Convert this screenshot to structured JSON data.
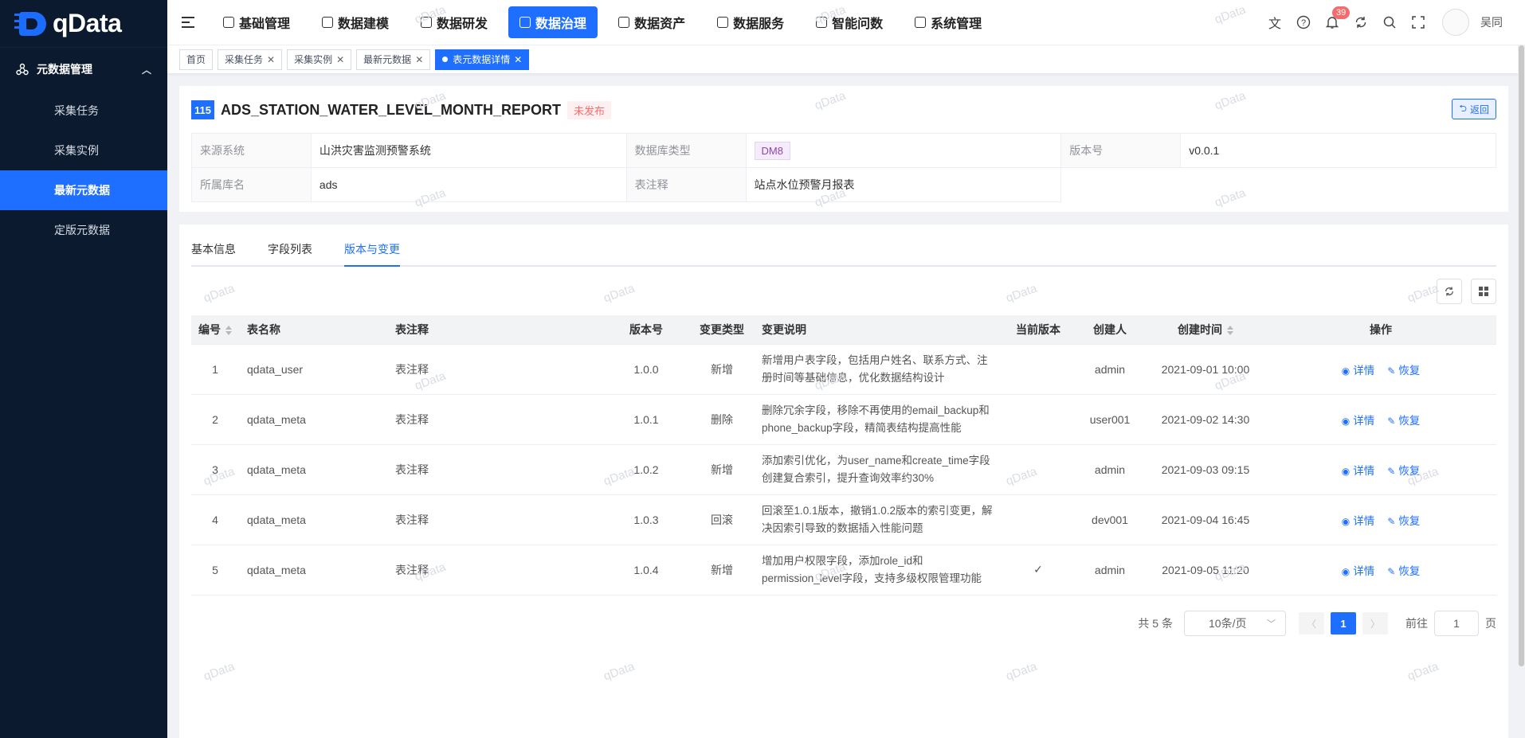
{
  "app": {
    "logo_text": "qData"
  },
  "sidebar": {
    "group_label": "元数据管理",
    "items": [
      {
        "label": "采集任务",
        "active": false
      },
      {
        "label": "采集实例",
        "active": false
      },
      {
        "label": "最新元数据",
        "active": true
      },
      {
        "label": "定版元数据",
        "active": false
      }
    ]
  },
  "header": {
    "nav": [
      {
        "label": "基础管理"
      },
      {
        "label": "数据建模"
      },
      {
        "label": "数据研发"
      },
      {
        "label": "数据治理",
        "active": true
      },
      {
        "label": "数据资产"
      },
      {
        "label": "数据服务"
      },
      {
        "label": "智能问数"
      },
      {
        "label": "系统管理"
      }
    ],
    "notification_count": "39",
    "username": "吴同"
  },
  "tabs_bar": [
    {
      "label": "首页",
      "closable": false
    },
    {
      "label": "采集任务",
      "closable": true
    },
    {
      "label": "采集实例",
      "closable": true
    },
    {
      "label": "最新元数据",
      "closable": true
    },
    {
      "label": "表元数据详情",
      "closable": true,
      "active": true
    }
  ],
  "detail": {
    "id": "115",
    "table_name": "ADS_STATION_WATER_LEVEL_MONTH_REPORT",
    "status": "未发布",
    "back_label": "返回",
    "fields": {
      "source_system_label": "来源系统",
      "source_system": "山洪灾害监测预警系统",
      "db_type_label": "数据库类型",
      "db_type": "DM8",
      "version_label": "版本号",
      "version": "v0.0.1",
      "db_name_label": "所属库名",
      "db_name": "ads",
      "comment_label": "表注释",
      "comment": "站点水位预警月报表"
    }
  },
  "content_tabs": [
    {
      "label": "基本信息"
    },
    {
      "label": "字段列表"
    },
    {
      "label": "版本与变更",
      "active": true
    }
  ],
  "table": {
    "columns": [
      "编号",
      "表名称",
      "表注释",
      "版本号",
      "变更类型",
      "变更说明",
      "当前版本",
      "创建人",
      "创建时间",
      "操作"
    ],
    "op_detail": "详情",
    "op_restore": "恢复",
    "rows": [
      {
        "no": "1",
        "name": "qdata_user",
        "comment": "表注释",
        "version": "1.0.0",
        "type": "新增",
        "desc": "新增用户表字段，包括用户姓名、联系方式、注册时间等基础信息，优化数据结构设计",
        "current": false,
        "creator": "admin",
        "time": "2021-09-01 10:00"
      },
      {
        "no": "2",
        "name": "qdata_meta",
        "comment": "表注释",
        "version": "1.0.1",
        "type": "删除",
        "desc": "删除冗余字段，移除不再使用的email_backup和phone_backup字段，精简表结构提高性能",
        "current": false,
        "creator": "user001",
        "time": "2021-09-02 14:30"
      },
      {
        "no": "3",
        "name": "qdata_meta",
        "comment": "表注释",
        "version": "1.0.2",
        "type": "新增",
        "desc": "添加索引优化，为user_name和create_time字段创建复合索引，提升查询效率约30%",
        "current": false,
        "creator": "admin",
        "time": "2021-09-03 09:15"
      },
      {
        "no": "4",
        "name": "qdata_meta",
        "comment": "表注释",
        "version": "1.0.3",
        "type": "回滚",
        "desc": "回滚至1.0.1版本，撤销1.0.2版本的索引变更，解决因索引导致的数据插入性能问题",
        "current": false,
        "creator": "dev001",
        "time": "2021-09-04 16:45"
      },
      {
        "no": "5",
        "name": "qdata_meta",
        "comment": "表注释",
        "version": "1.0.4",
        "type": "新增",
        "desc": "增加用户权限字段，添加role_id和permission_level字段，支持多级权限管理功能",
        "current": true,
        "creator": "admin",
        "time": "2021-09-05 11:20"
      }
    ]
  },
  "pagination": {
    "total": "共 5 条",
    "page_size": "10条/页",
    "current_page": "1",
    "goto_label": "前往",
    "goto_value": "1",
    "page_suffix": "页"
  },
  "watermark": "qData"
}
